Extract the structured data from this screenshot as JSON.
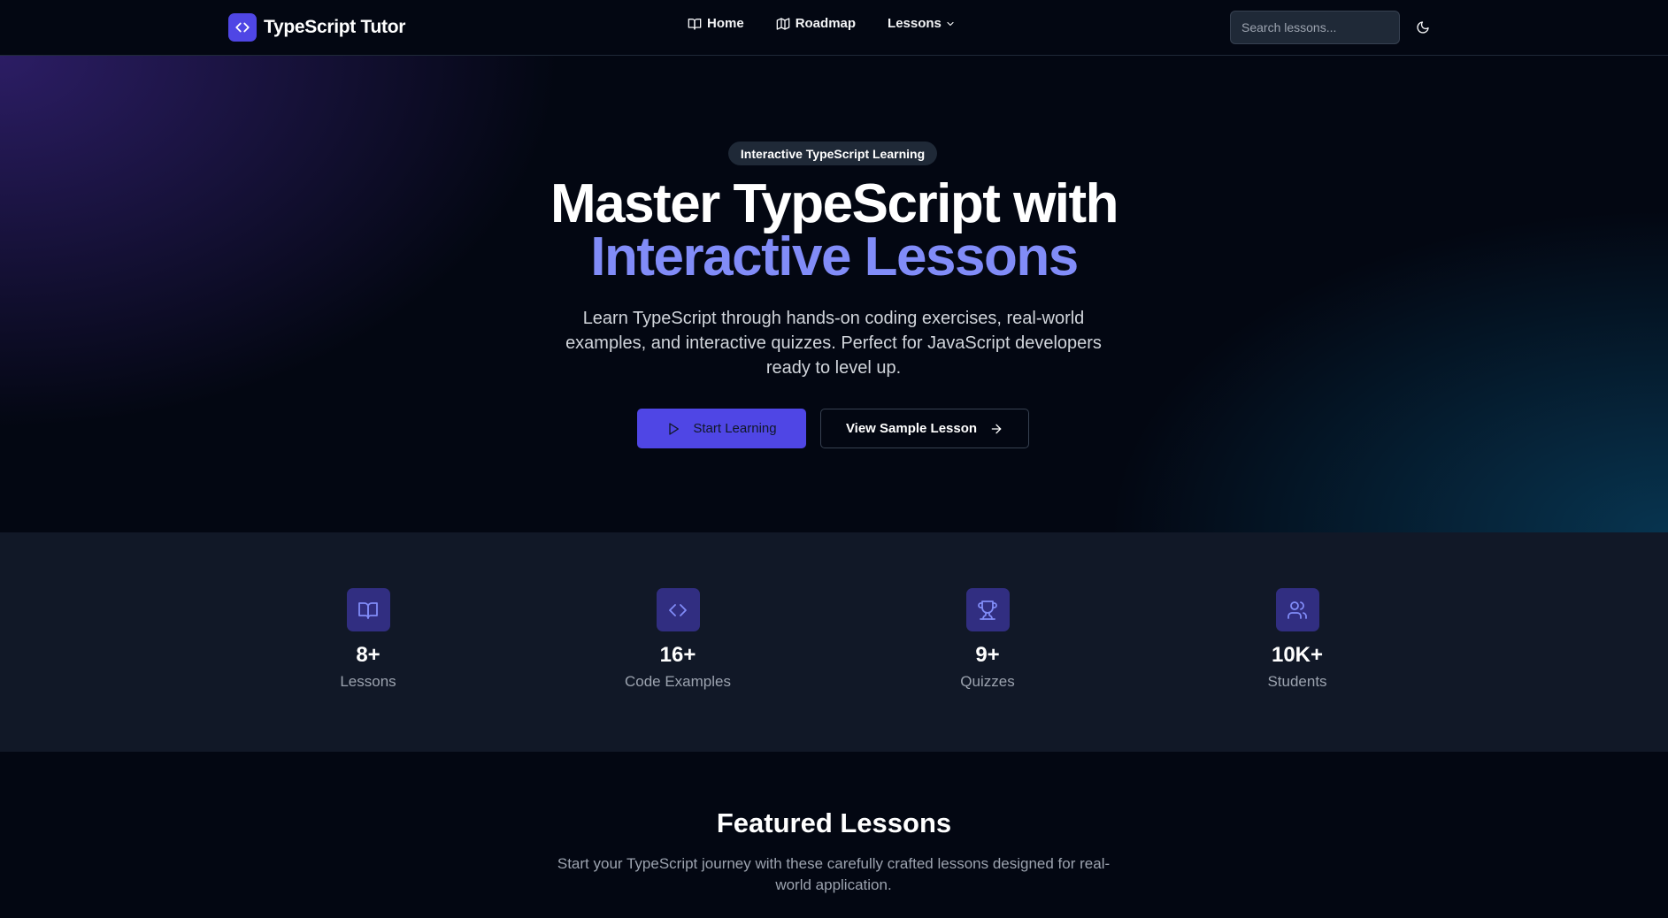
{
  "header": {
    "brand": "TypeScript Tutor",
    "nav": [
      {
        "label": "Home",
        "icon": "book-open-icon"
      },
      {
        "label": "Roadmap",
        "icon": "map-icon"
      },
      {
        "label": "Lessons",
        "icon": "chevron-down-icon"
      }
    ],
    "search_placeholder": "Search lessons...",
    "theme_icon": "moon-icon"
  },
  "hero": {
    "badge": "Interactive TypeScript Learning",
    "title_line1": "Master TypeScript with",
    "title_line2": "Interactive Lessons",
    "subtitle": "Learn TypeScript through hands-on coding exercises, real-world examples, and interactive quizzes. Perfect for JavaScript developers ready to level up.",
    "primary_cta": "Start Learning",
    "secondary_cta": "View Sample Lesson"
  },
  "stats": [
    {
      "value": "8+",
      "label": "Lessons",
      "icon": "book-open-icon"
    },
    {
      "value": "16+",
      "label": "Code Examples",
      "icon": "code-icon"
    },
    {
      "value": "9+",
      "label": "Quizzes",
      "icon": "trophy-icon"
    },
    {
      "value": "10K+",
      "label": "Students",
      "icon": "users-icon"
    }
  ],
  "featured": {
    "title": "Featured Lessons",
    "subtitle": "Start your TypeScript journey with these carefully crafted lessons designed for real-world application."
  },
  "colors": {
    "accent": "#4f46e5",
    "accent_text": "#818cf8",
    "background": "#030712",
    "stats_background": "#111827"
  }
}
